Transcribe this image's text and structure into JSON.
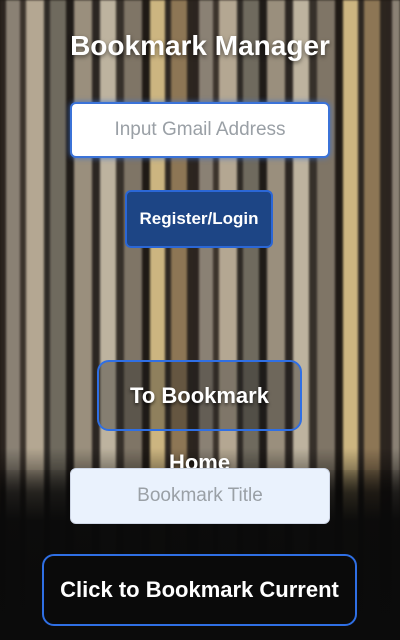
{
  "app": {
    "title": "Bookmark Manager"
  },
  "email_input": {
    "placeholder": "Input Gmail Address",
    "value": ""
  },
  "register_login": {
    "label": "Register/Login"
  },
  "to_bookmark_home": {
    "label": "To Bookmark Home"
  },
  "bookmark_title_input": {
    "placeholder": "Bookmark Title",
    "value": ""
  },
  "bookmark_current_page": {
    "label": "Click to Bookmark Current Page"
  },
  "colors": {
    "accent": "#2f6fe4",
    "button_primary": "#1d4585",
    "text_on_dark": "#ffffff"
  }
}
